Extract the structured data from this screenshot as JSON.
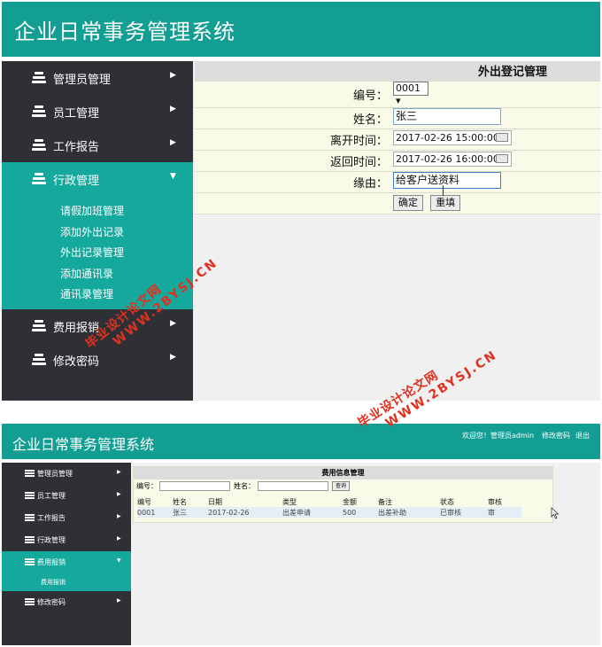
{
  "screen1": {
    "app_title": "企业日常事务管理系统",
    "nav": [
      {
        "label": "管理员管理"
      },
      {
        "label": "员工管理"
      },
      {
        "label": "工作报告"
      },
      {
        "label": "行政管理",
        "active": true
      },
      {
        "label": "费用报销"
      },
      {
        "label": "修改密码"
      }
    ],
    "sub_nav": [
      "请假加班管理",
      "添加外出记录",
      "外出记录管理",
      "添加通讯录",
      "通讯录管理"
    ],
    "form": {
      "title": "外出登记管理",
      "id_label": "编号：",
      "id_value": "0001 ▾",
      "name_label": "姓名：",
      "name_value": "张三",
      "leave_label": "离开时间：",
      "leave_value": "2017-02-26 15:00:00",
      "return_label": "返回时间：",
      "return_value": "2017-02-26 16:00:00",
      "reason_label": "缘由：",
      "reason_value": "给客户送资料",
      "confirm_button": "确定",
      "reset_button": "重填"
    },
    "arrow_right": "▶",
    "arrow_down": "▼"
  },
  "screen2": {
    "app_title": "企业日常事务管理系统",
    "header_links": {
      "welcome": "欢迎您！管理员admin",
      "change_password": "修改密码",
      "logout": "退出"
    },
    "nav": [
      {
        "label": "管理员管理"
      },
      {
        "label": "员工管理"
      },
      {
        "label": "工作报告"
      },
      {
        "label": "行政管理"
      },
      {
        "label": "费用报销",
        "active": true
      },
      {
        "label": "修改密码"
      }
    ],
    "sub_nav": [
      "费用报销"
    ],
    "panel": {
      "title": "费用信息管理",
      "id_label": "编号：",
      "name_label": "姓名：",
      "query_button": "查询",
      "columns": [
        "编号",
        "姓名",
        "日期",
        "类型",
        "金额",
        "备注",
        "状态",
        "审核"
      ],
      "rows": [
        [
          "0001",
          "张三",
          "2017-02-26",
          "出差申请",
          "500",
          "出差补助",
          "已审核",
          "审"
        ]
      ]
    }
  },
  "watermark": {
    "text_a": "毕业设计论文网",
    "text_b": "WWW.2BYSJ.CN"
  },
  "colors": {
    "header_teal": "#139e94",
    "sidebar_dark": "#2f3035",
    "active_teal": "#15a89d",
    "watermark_red": "#e03020"
  }
}
